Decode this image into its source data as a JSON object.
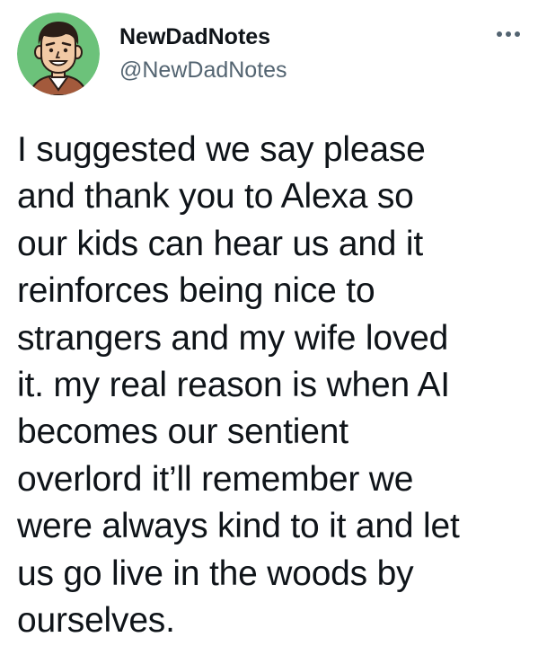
{
  "author": {
    "display_name": "NewDadNotes",
    "handle": "@NewDadNotes",
    "avatar_icon": "cartoon-dad-avatar-icon",
    "avatar_bg_color": "#6cc27a"
  },
  "more_icon": "more-horizontal-icon",
  "tweet": {
    "lines": [
      "I suggested we say please",
      "and thank you to Alexa so",
      "our kids can hear us and it",
      "reinforces being nice to",
      "strangers and my wife loved",
      "it. my real reason is when AI",
      "becomes our sentient",
      "overlord it’ll remember we",
      "were always kind to it and let",
      "us go live in the woods by",
      "ourselves."
    ]
  },
  "colors": {
    "text": "#0f1419",
    "secondary_text": "#536471",
    "background": "#ffffff"
  }
}
